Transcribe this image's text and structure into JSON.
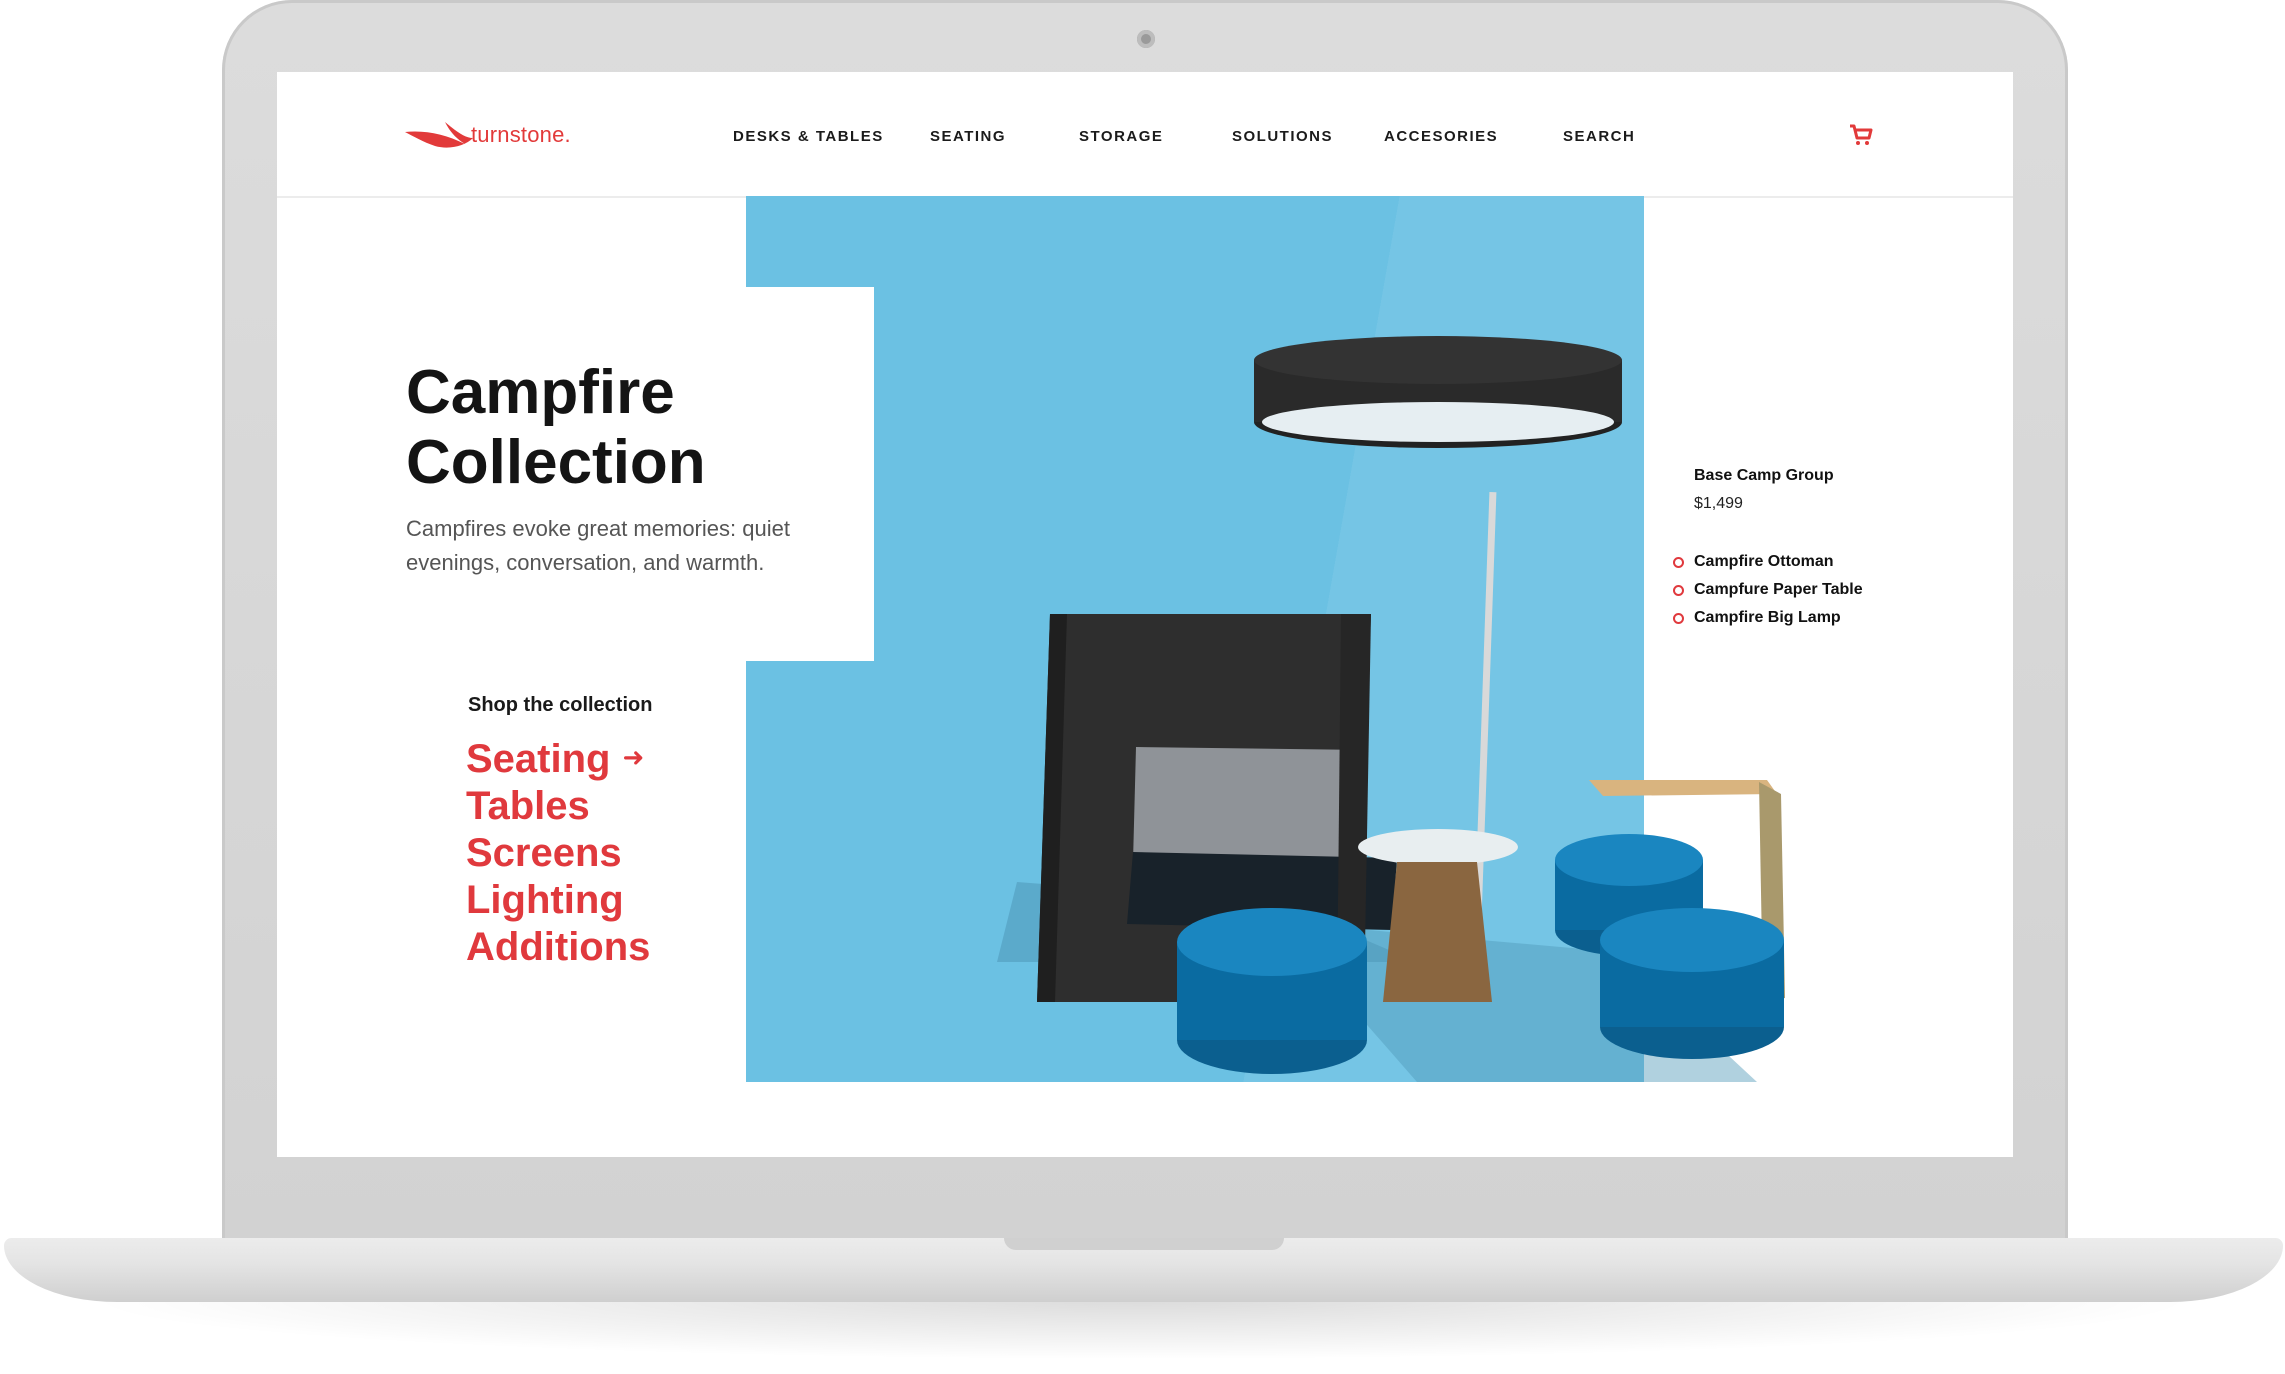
{
  "brand": {
    "name": "turnstone.",
    "color": "#e23a3a"
  },
  "nav": {
    "items": [
      {
        "label": "DESKS & TABLES"
      },
      {
        "label": "SEATING"
      },
      {
        "label": "STORAGE"
      },
      {
        "label": "SOLUTIONS"
      },
      {
        "label": "ACCESORIES"
      },
      {
        "label": "SEARCH"
      }
    ],
    "cart_icon": "shopping-cart-icon"
  },
  "hero": {
    "title_line1": "Campfire",
    "title_line2": "Collection",
    "subtitle": "Campfires evoke great memories: quiet evenings, conversation, and warmth.",
    "background_color": "#6bc1e3"
  },
  "shop": {
    "label": "Shop the collection",
    "links": [
      {
        "label": "Seating"
      },
      {
        "label": "Tables"
      },
      {
        "label": "Screens"
      },
      {
        "label": "Lighting"
      },
      {
        "label": "Additions"
      }
    ],
    "arrow_icon": "arrow-right-icon",
    "link_color": "#e0393d"
  },
  "product": {
    "group_name": "Base Camp Group",
    "price": "$1,499",
    "items": [
      {
        "label": "Campfire Ottoman"
      },
      {
        "label": "Campfure Paper Table"
      },
      {
        "label": "Campfire Big Lamp"
      }
    ]
  }
}
